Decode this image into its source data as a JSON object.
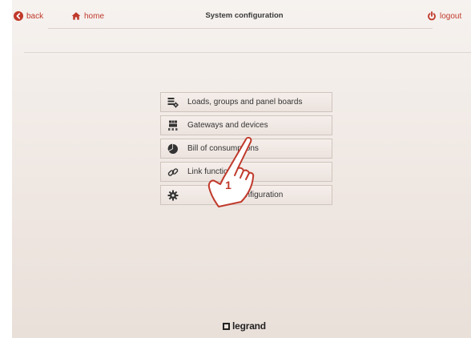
{
  "header": {
    "back_label": "back",
    "home_label": "home",
    "title": "System configuration",
    "logout_label": "logout"
  },
  "menu": {
    "items": [
      {
        "label": "Loads, groups and panel boards",
        "icon": "panel-board-icon"
      },
      {
        "label": "Gateways and devices",
        "icon": "gateway-icon"
      },
      {
        "label": "Bill of consumptions",
        "icon": "pie-chart-icon"
      },
      {
        "label": "Link functionality",
        "icon": "link-icon"
      },
      {
        "label": "configuration",
        "icon": "gear-icon"
      }
    ]
  },
  "annotation": {
    "step_number": "1"
  },
  "footer": {
    "brand": "legrand"
  },
  "colors": {
    "accent": "#c0392b",
    "background": "#f2ebe7"
  }
}
